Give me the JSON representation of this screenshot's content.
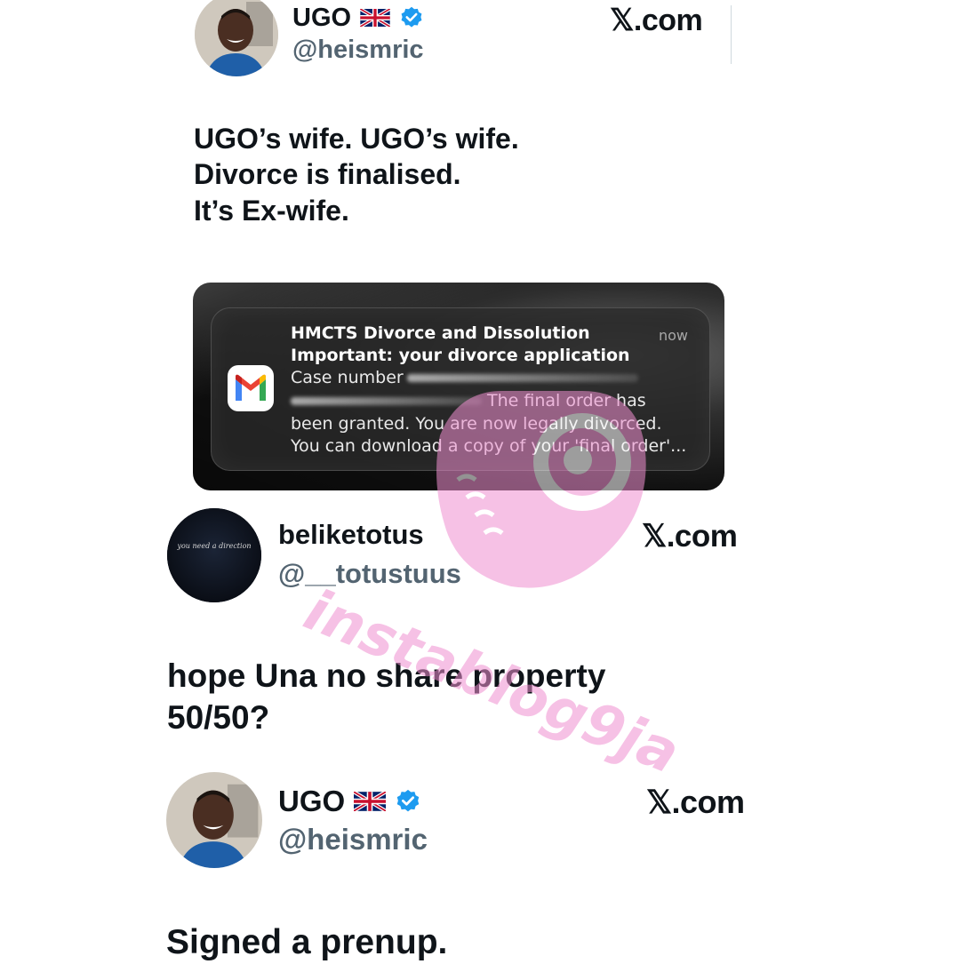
{
  "tweet1": {
    "name": "UGO",
    "handle": "@heismric",
    "site": "𝕏.com",
    "text": "UGO’s wife. UGO’s wife.\nDivorce is finalised.\nIt’s Ex-wife."
  },
  "notification": {
    "time": "now",
    "app_icon": "gmail-icon",
    "lines": [
      "HMCTS Divorce and Dissolution",
      "Important: your divorce application",
      "Case number",
      "The final order has",
      "been granted. You are now legally divorced.",
      "You can download a copy of your 'final order'..."
    ]
  },
  "tweet2": {
    "name": "beliketotus",
    "handle": "@__totustuus",
    "avatar_text": "you need a direction",
    "site": "𝕏.com",
    "text": "hope Una no share property\n50/50?"
  },
  "tweet3": {
    "name": "UGO",
    "handle": "@heismric",
    "site": "𝕏.com",
    "text": "Signed a prenup."
  },
  "watermark": {
    "text": "instablog9ja",
    "color": "#f08fd0"
  },
  "colors": {
    "verified": "#1d9bf0",
    "handle": "#536471",
    "text": "#0f1419"
  }
}
